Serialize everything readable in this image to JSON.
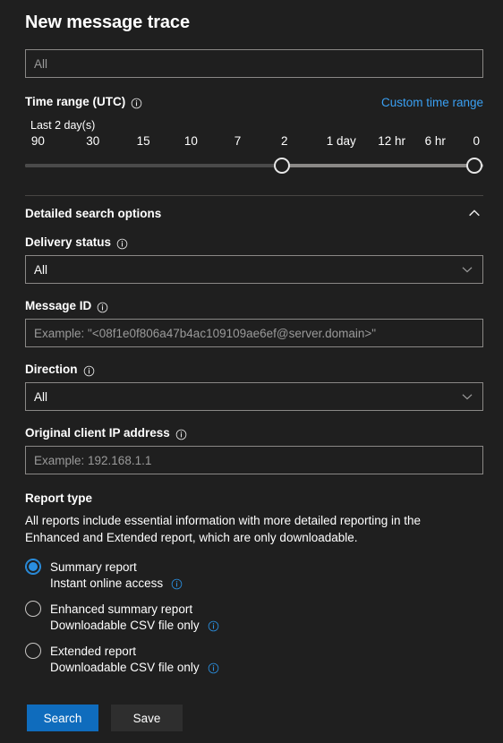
{
  "page": {
    "title": "New message trace"
  },
  "recipient_search": {
    "placeholder": "All",
    "value": ""
  },
  "time_range": {
    "label": "Time range (UTC)",
    "info_icon": "info-icon",
    "custom_link": "Custom time range",
    "caption": "Last 2 day(s)",
    "ticks": [
      {
        "label": "90",
        "pos": 2.8
      },
      {
        "label": "30",
        "pos": 14.8
      },
      {
        "label": "15",
        "pos": 25.8
      },
      {
        "label": "10",
        "pos": 36.2
      },
      {
        "label": "7",
        "pos": 46.4
      },
      {
        "label": "2",
        "pos": 56.6
      },
      {
        "label": "1 day",
        "pos": 69.0
      },
      {
        "label": "12 hr",
        "pos": 80.0
      },
      {
        "label": "6 hr",
        "pos": 89.5
      },
      {
        "label": "0",
        "pos": 98.5
      }
    ],
    "thumb_start_pos": 56.0,
    "thumb_end_pos": 98.0
  },
  "detailed_search": {
    "title": "Detailed search options",
    "expanded": true,
    "collapse_icon": "chevron-up-icon"
  },
  "delivery_status": {
    "label": "Delivery status",
    "value": "All",
    "chevron_icon": "chevron-down-icon"
  },
  "message_id": {
    "label": "Message ID",
    "placeholder": "Example: \"<08f1e0f806a47b4ac109109ae6ef@server.domain>\"",
    "value": ""
  },
  "direction": {
    "label": "Direction",
    "value": "All",
    "chevron_icon": "chevron-down-icon"
  },
  "client_ip": {
    "label": "Original client IP address",
    "placeholder": "Example: 192.168.1.1",
    "value": ""
  },
  "report_type": {
    "label": "Report type",
    "description": "All reports include essential information with more detailed reporting in the Enhanced and Extended report, which are only downloadable.",
    "options": [
      {
        "label": "Summary report",
        "sub": "Instant online access",
        "selected": true
      },
      {
        "label": "Enhanced summary report",
        "sub": "Downloadable CSV file only",
        "selected": false
      },
      {
        "label": "Extended report",
        "sub": "Downloadable CSV file only",
        "selected": false
      }
    ]
  },
  "actions": {
    "search_label": "Search",
    "save_label": "Save"
  },
  "colors": {
    "background": "#1f1f1f",
    "accent_blue": "#0f6cbd",
    "link_blue": "#3aa0f3",
    "radio_blue": "#2a8fe0",
    "border": "#8a8886",
    "divider": "#484644",
    "track_active": "#8a8886",
    "track_inactive": "#4a4a4a"
  }
}
